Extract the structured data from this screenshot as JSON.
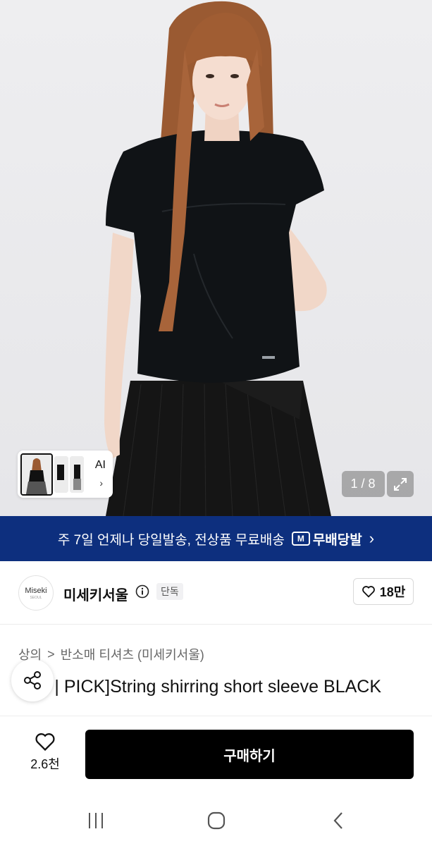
{
  "gallery": {
    "pager_current": "1",
    "pager_sep": "/",
    "pager_total": "8",
    "thumb_ai_label": "AI",
    "thumb_chevron": "›"
  },
  "banner": {
    "text": "주 7일 언제나 당일발송, 전상품 무료배송",
    "logo_mark": "M",
    "logo_text": "무배당발",
    "chevron": "›",
    "bg_color": "#0d2f7e"
  },
  "brand": {
    "logo_text": "Miseki",
    "logo_sub": "SEOUL",
    "name": "미세키서울",
    "info_icon": "info-icon",
    "exclusive_badge": "단독",
    "like_count": "18만"
  },
  "breadcrumb": {
    "category": "상의",
    "separator": ">",
    "subcategory": "반소매 티셔츠 (미세키서울)"
  },
  "product": {
    "title": "[MS | PICK]String shirring short sleeve BLACK"
  },
  "action_bar": {
    "wish_count": "2.6천",
    "buy_label": "구매하기"
  }
}
